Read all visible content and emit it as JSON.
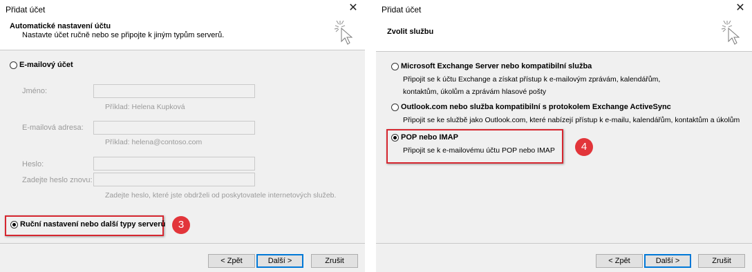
{
  "left_dialog": {
    "window_title": "Přidat účet",
    "header_title": "Automatické nastavení účtu",
    "header_subtitle": "Nastavte účet ručně nebo se připojte k jiným typům serverů.",
    "email_account_option": "E-mailový účet",
    "name_label": "Jméno:",
    "name_value": "",
    "name_hint": "Příklad: Helena Kupková",
    "email_label": "E-mailová adresa:",
    "email_value": "",
    "email_hint": "Příklad: helena@contoso.com",
    "password_label": "Heslo:",
    "password_value": "",
    "password_repeat_label": "Zadejte heslo znovu:",
    "password_repeat_value": "",
    "password_hint": "Zadejte heslo, které jste obdrželi od poskytovatele internetových služeb.",
    "manual_option": "Ruční nastavení nebo další typy serverů",
    "step_badge": "3",
    "back_button": "< Zpět",
    "next_button": "Další >",
    "cancel_button": "Zrušit"
  },
  "right_dialog": {
    "window_title": "Přidat účet",
    "header_title": "Zvolit službu",
    "options": [
      {
        "label": "Microsoft Exchange Server nebo kompatibilní služba",
        "desc1": "Připojit se k účtu Exchange a získat přístup k e-mailovým zprávám, kalendářům,",
        "desc2": "kontaktům, úkolům a zprávám hlasové pošty"
      },
      {
        "label": "Outlook.com nebo služba kompatibilní s protokolem Exchange ActiveSync",
        "desc1": "Připojit se ke službě jako Outlook.com, které nabízejí přístup k e-mailu, kalendářům, kontaktům a úkolům"
      },
      {
        "label": "POP nebo IMAP",
        "desc1": "Připojit se k e-mailovému účtu POP nebo IMAP"
      }
    ],
    "step_badge": "4",
    "back_button": "< Zpět",
    "next_button": "Další >",
    "cancel_button": "Zrušit"
  },
  "colors": {
    "highlight": "#d6262f",
    "badge": "#e2353a",
    "default_button_border": "#0078d7"
  },
  "icons": {
    "close": "close-icon",
    "wizard": "magic-wand-cursor-icon"
  }
}
